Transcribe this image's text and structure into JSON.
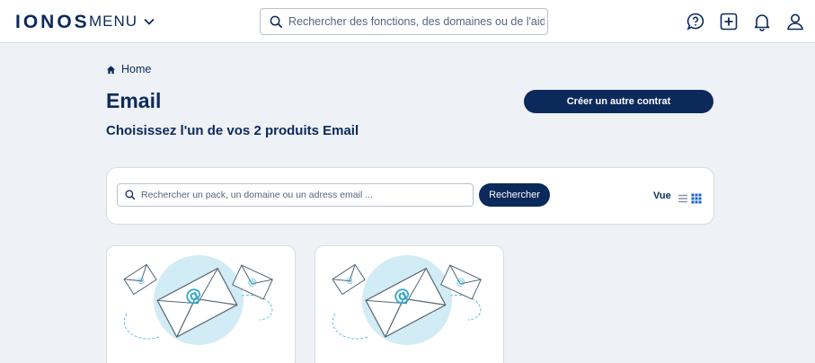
{
  "header": {
    "logo": "IONOS",
    "menu_label": "MENU",
    "search_placeholder": "Rechercher des fonctions, des domaines ou de l'aide",
    "icons": [
      "help-icon",
      "add-icon",
      "notification-bell-icon",
      "user-account-icon"
    ]
  },
  "breadcrumb": {
    "home_label": "Home"
  },
  "page": {
    "title": "Email",
    "subtitle": "Choisissez l'un de vos 2 produits Email",
    "cta_label": "Créer un autre contrat"
  },
  "filter": {
    "search_placeholder": "Rechercher un pack, un domaine ou un adress email ...",
    "search_button": "Rechercher",
    "view_label": "Vue",
    "view_modes": [
      "list-view-icon",
      "grid-view-icon"
    ],
    "active_view": "grid"
  },
  "products": [
    {
      "illustration": "email-envelopes-illustration"
    },
    {
      "illustration": "email-envelopes-illustration"
    }
  ],
  "colors": {
    "brand_navy": "#0b2a5b",
    "accent_cyan": "#4ab8d8",
    "page_background": "#eef1f5"
  }
}
